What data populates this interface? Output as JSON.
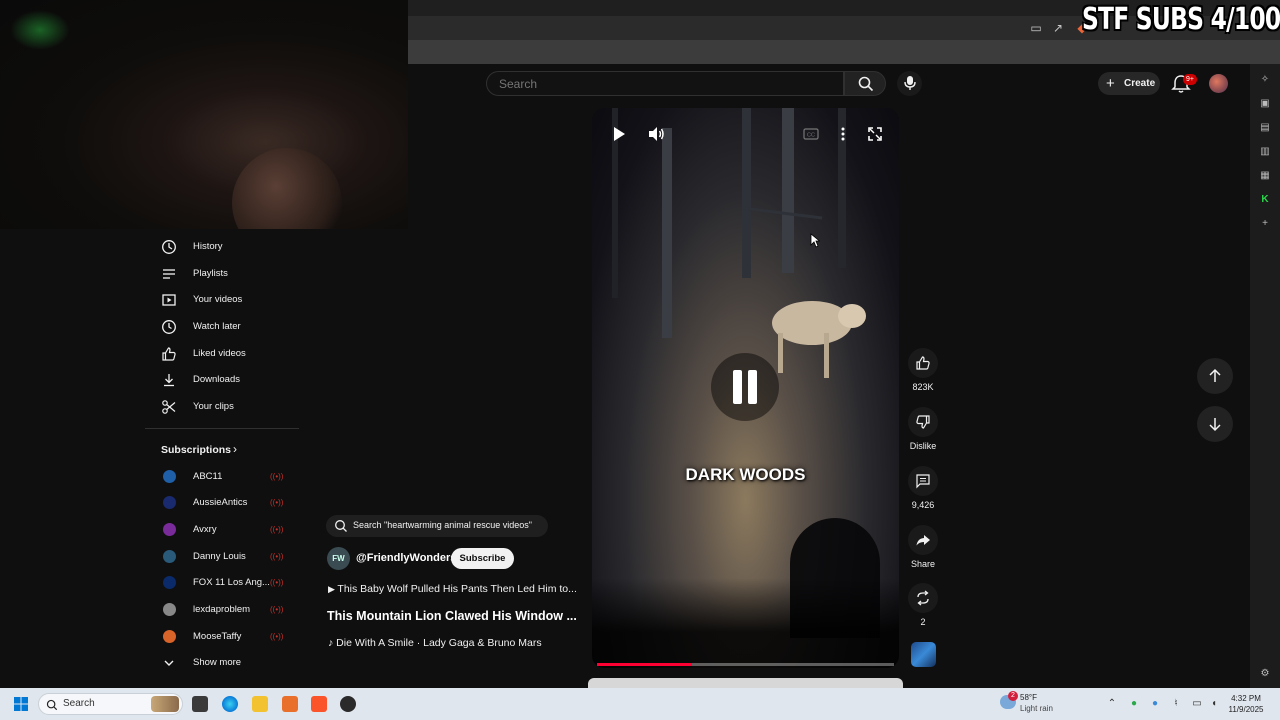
{
  "overlay": {
    "stream_text": "STF SUBS 4/100"
  },
  "header": {
    "search_placeholder": "Search",
    "create_label": "Create",
    "notification_count": "9+"
  },
  "sidebar": {
    "you_items": [
      {
        "label": "History",
        "icon": "history-icon"
      },
      {
        "label": "Playlists",
        "icon": "playlists-icon"
      },
      {
        "label": "Your videos",
        "icon": "your-videos-icon"
      },
      {
        "label": "Watch later",
        "icon": "watch-later-icon"
      },
      {
        "label": "Liked videos",
        "icon": "like-icon"
      },
      {
        "label": "Downloads",
        "icon": "download-icon"
      },
      {
        "label": "Your clips",
        "icon": "scissors-icon"
      }
    ],
    "subscriptions_title": "Subscriptions",
    "subscriptions": [
      {
        "label": "ABC11",
        "color": "#1e5fa8"
      },
      {
        "label": "AussieAntics",
        "color": "#1a2a6e"
      },
      {
        "label": "Avxry",
        "color": "#7a2b9a"
      },
      {
        "label": "Danny Louis",
        "color": "#2a5a7a"
      },
      {
        "label": "FOX 11 Los Ang...",
        "color": "#0a2a6a"
      },
      {
        "label": "lexdaproblem",
        "color": "#888888"
      },
      {
        "label": "MooseTaffy",
        "color": "#d8642a"
      }
    ],
    "show_more": "Show more"
  },
  "video": {
    "overlay_title": "DARK WOODS",
    "progress": 0.32
  },
  "info": {
    "search_chip": "Search \"heartwarming animal rescue videos\"",
    "channel_avatar_text": "FW",
    "channel_name": "@FriendlyWonders",
    "subscribe_label": "Subscribe",
    "next_video": "This Baby Wolf Pulled His Pants Then Led Him to...",
    "title": "This Mountain Lion Clawed His Window ...",
    "music": "Die With A Smile · Lady Gaga & Bruno Mars"
  },
  "actions": {
    "likes": "823K",
    "dislike_label": "Dislike",
    "comments": "9,426",
    "share_label": "Share",
    "remix_count": "2"
  },
  "taskbar": {
    "search_label": "Search",
    "weather_temp": "58°F",
    "weather_cond": "Light rain",
    "weather_badge": "2",
    "time": "4:32 PM",
    "date": "11/9/2025"
  }
}
